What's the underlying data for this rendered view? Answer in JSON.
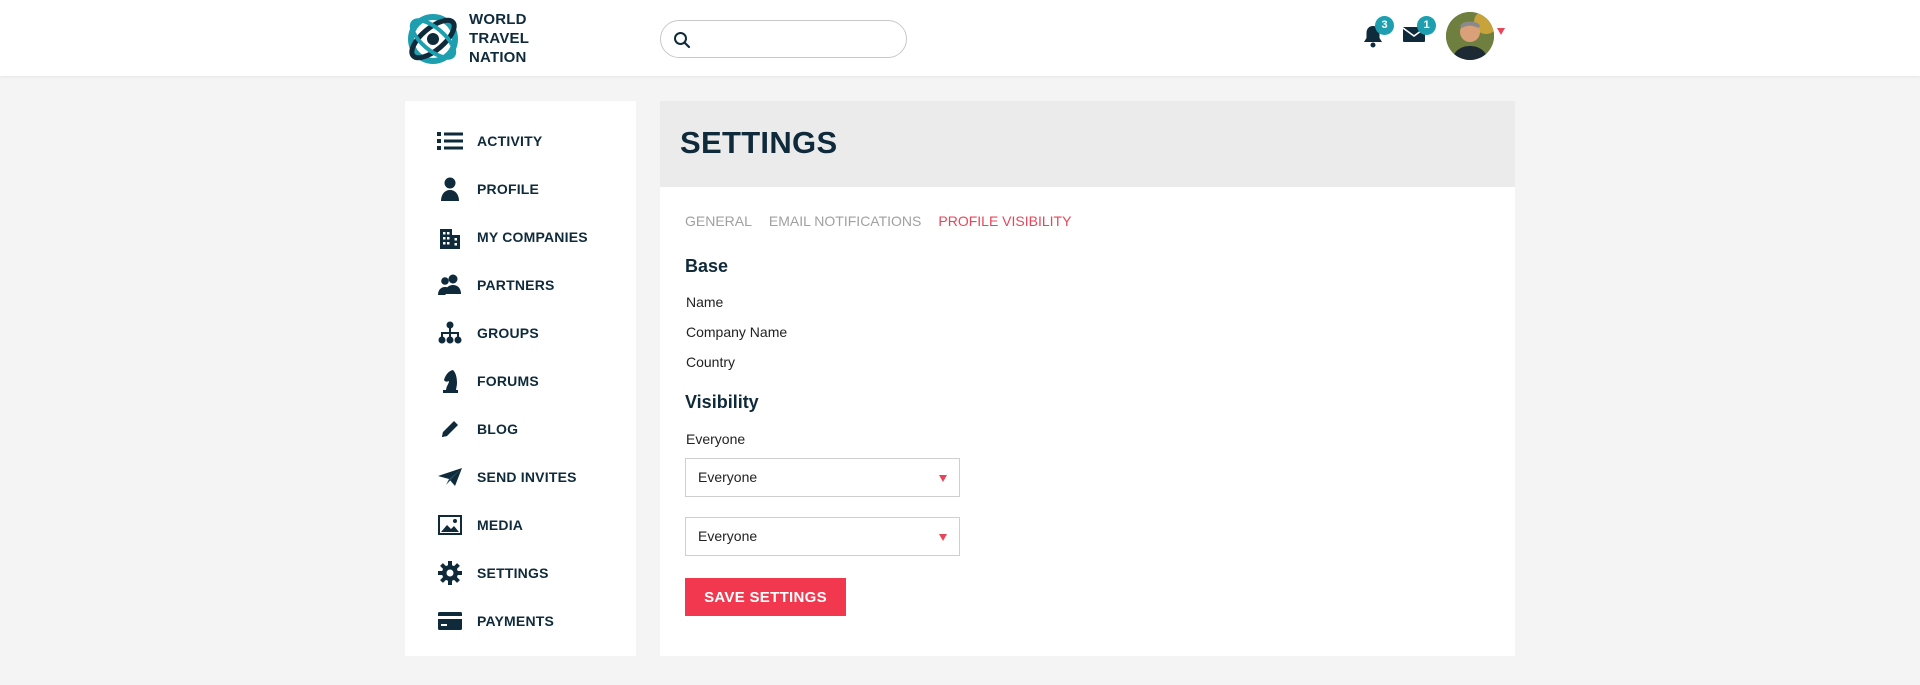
{
  "brand": {
    "name_lines": [
      "WORLD",
      "TRAVEL",
      "NATION"
    ],
    "primary_color": "#0f2a3a",
    "accent_color": "#1d9fb0"
  },
  "header": {
    "search": {
      "placeholder": "",
      "value": ""
    },
    "notifications": {
      "icon": "bell-icon",
      "count": "3"
    },
    "messages": {
      "icon": "mail-icon",
      "count": "1"
    },
    "avatar": {
      "icon": "user-avatar"
    }
  },
  "sidebar": {
    "items": [
      {
        "label": "ACTIVITY",
        "icon": "list-icon"
      },
      {
        "label": "PROFILE",
        "icon": "person-icon"
      },
      {
        "label": "MY COMPANIES",
        "icon": "building-icon"
      },
      {
        "label": "PARTNERS",
        "icon": "people-icon"
      },
      {
        "label": "GROUPS",
        "icon": "org-chart-icon"
      },
      {
        "label": "FORUMS",
        "icon": "chess-knight-icon"
      },
      {
        "label": "BLOG",
        "icon": "pencil-icon"
      },
      {
        "label": "SEND INVITES",
        "icon": "paper-plane-icon"
      },
      {
        "label": "MEDIA",
        "icon": "image-icon"
      },
      {
        "label": "SETTINGS",
        "icon": "gear-icon"
      },
      {
        "label": "PAYMENTS",
        "icon": "credit-card-icon"
      }
    ]
  },
  "main": {
    "title": "SETTINGS",
    "tabs": [
      {
        "label": "GENERAL",
        "active": false
      },
      {
        "label": "EMAIL NOTIFICATIONS",
        "active": false
      },
      {
        "label": "PROFILE VISIBILITY",
        "active": true
      }
    ],
    "base": {
      "title": "Base",
      "fields": [
        "Name",
        "Company Name",
        "Country"
      ]
    },
    "visibility": {
      "title": "Visibility",
      "label": "Everyone",
      "selects": [
        {
          "value": "Everyone"
        },
        {
          "value": "Everyone"
        }
      ]
    },
    "save_label": "SAVE SETTINGS",
    "accent_red": "#f2384e"
  }
}
